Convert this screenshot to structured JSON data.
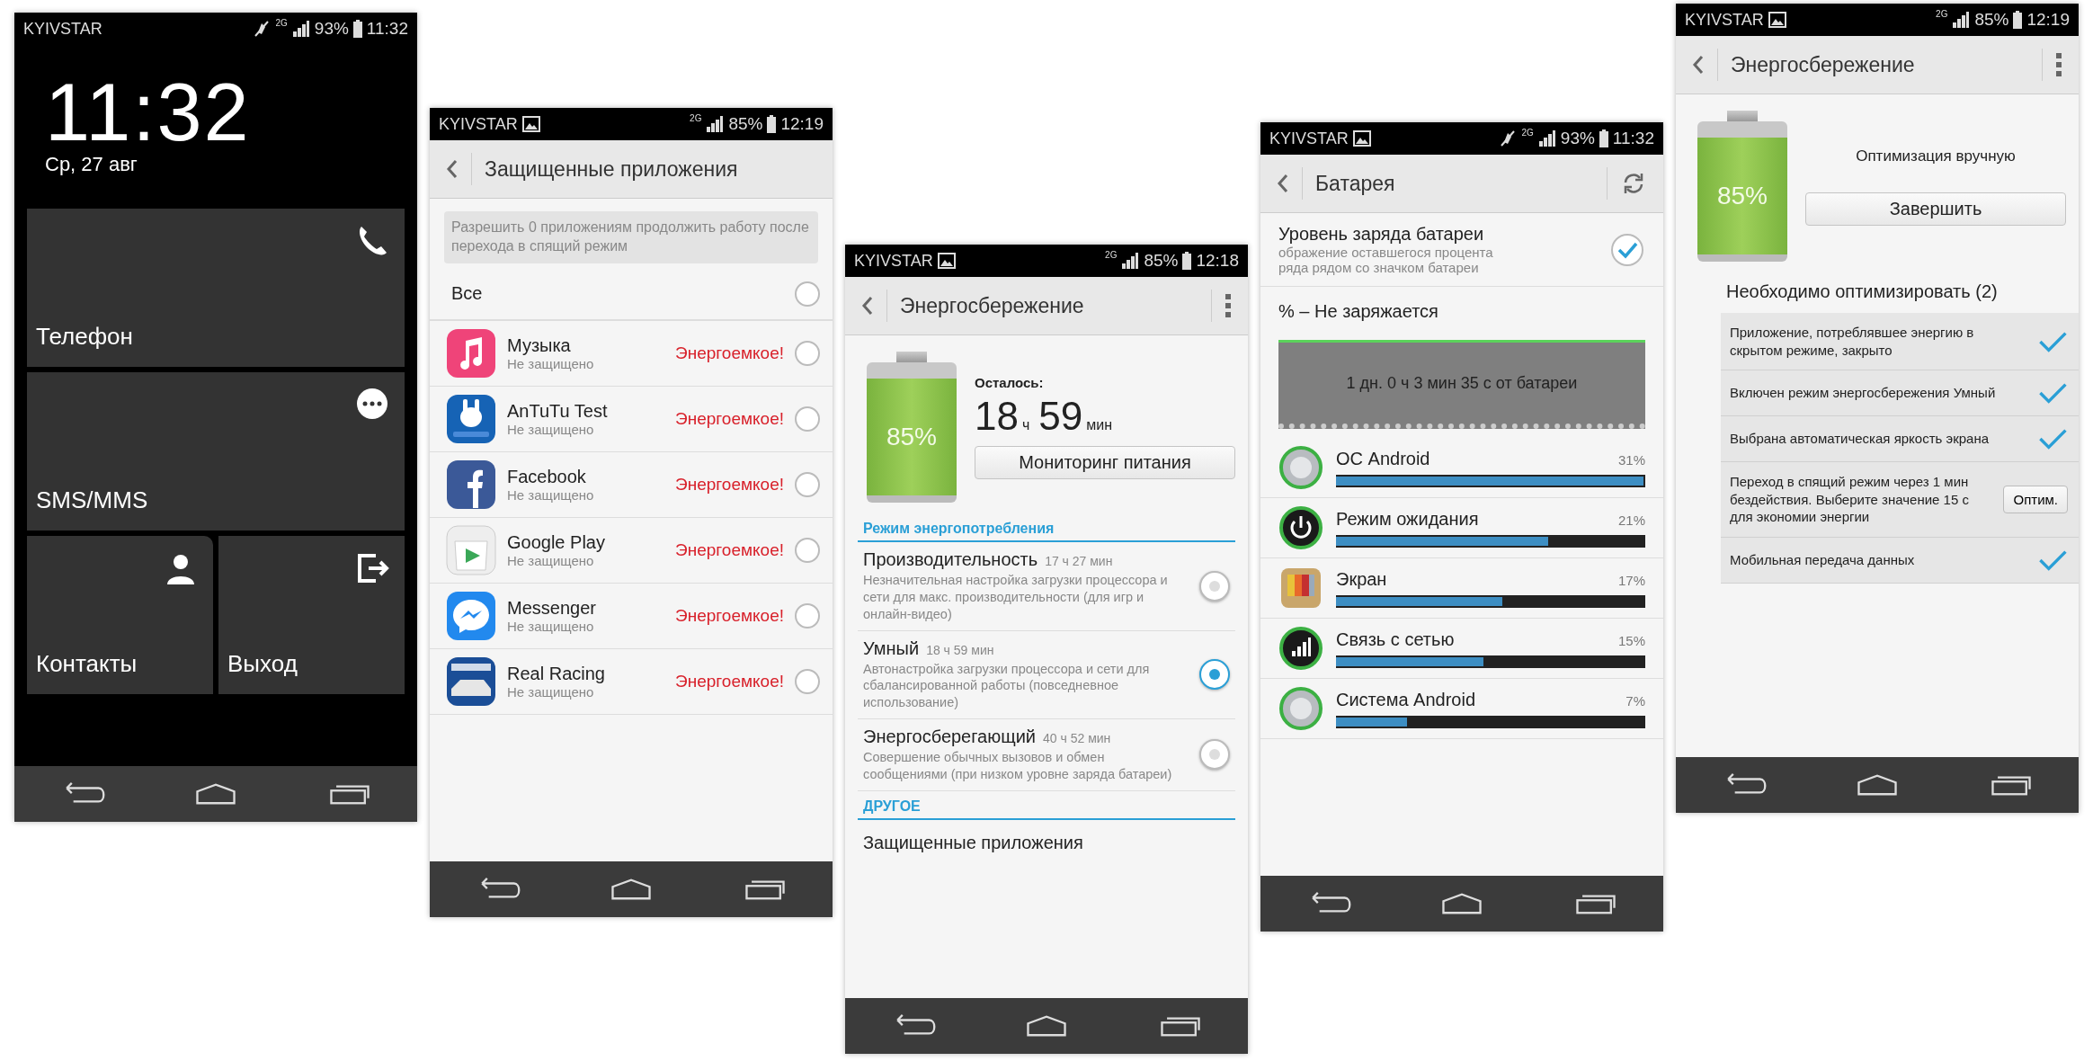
{
  "phones": [
    {
      "kind": "home",
      "status": {
        "carrier": "KYIVSTAR",
        "image_icon": false,
        "muted": true,
        "network": "2G",
        "battery": "93%",
        "time": "11:32"
      },
      "clock": "11:32",
      "date": "Ср, 27 авг",
      "tiles": [
        {
          "label": "Телефон"
        },
        {
          "label": "SMS/MMS"
        },
        {
          "label": "Контакты"
        },
        {
          "label": "Выход"
        }
      ]
    },
    {
      "kind": "protected",
      "status": {
        "carrier": "KYIVSTAR",
        "image_icon": true,
        "muted": false,
        "network": "2G",
        "battery": "85%",
        "time": "12:19"
      },
      "title": "Защищенные приложения",
      "notice": "Разрешить 0 приложениям продолжить работу после перехода в спящий режим",
      "all_label": "Все",
      "all_checked": false,
      "apps": [
        {
          "name": "Музыка",
          "status": "Не защищено",
          "warning": "Энергоемкое!",
          "checked": false
        },
        {
          "name": "AnTuTu Test",
          "status": "Не защищено",
          "warning": "Энергоемкое!",
          "checked": false
        },
        {
          "name": "Facebook",
          "status": "Не защищено",
          "warning": "Энергоемкое!",
          "checked": false
        },
        {
          "name": "Google Play",
          "status": "Не защищено",
          "warning": "Энергоемкое!",
          "checked": false
        },
        {
          "name": "Messenger",
          "status": "Не защищено",
          "warning": "Энергоемкое!",
          "checked": false
        },
        {
          "name": "Real Racing",
          "status": "Не защищено",
          "warning": "Энергоемкое!",
          "checked": false
        }
      ]
    },
    {
      "kind": "power",
      "status": {
        "carrier": "KYIVSTAR",
        "image_icon": true,
        "muted": false,
        "network": "2G",
        "battery": "85%",
        "time": "12:18"
      },
      "title": "Энергосбережение",
      "battery_percent": "85%",
      "remaining_label": "Осталось:",
      "hours": "18",
      "hours_unit": "ч",
      "minutes": "59",
      "minutes_unit": "мин",
      "monitor_button": "Мониторинг питания",
      "section": "Режим энергопотребления",
      "modes": [
        {
          "name": "Производительность",
          "time": "17 ч 27 мин",
          "description": "Незначительная настройка загрузки процессора и сети для макс. производительности (для игр и онлайн-видео)",
          "selected": false
        },
        {
          "name": "Умный",
          "time": "18 ч 59 мин",
          "description": "Автонастройка загрузки процессора и сети для сбалансированной работы (повседневное использование)",
          "selected": true
        },
        {
          "name": "Энергосберегающий",
          "time": "40 ч 52 мин",
          "description": "Совершение обычных вызовов и обмен сообщениями (при низком уровне заряда батареи)",
          "selected": false
        }
      ],
      "other_section": "ДРУГОЕ",
      "other_item": "Защищенные приложения"
    },
    {
      "kind": "battery",
      "status": {
        "carrier": "KYIVSTAR",
        "image_icon": true,
        "muted": true,
        "network": "2G",
        "battery": "93%",
        "time": "11:32"
      },
      "title": "Батарея",
      "setting": {
        "title": "Уровень заряда батареи",
        "description_lines": [
          "ображение оставшегося процента",
          "ряда рядом со значком батареи"
        ],
        "checked": true
      },
      "charge_status": "% – Не заряжается",
      "graph_caption": "1 дн. 0 ч 3 мин 35 с от батареи",
      "usage": [
        {
          "name": "ОС Android",
          "percent": "31%",
          "level": 1.0
        },
        {
          "name": "Режим ожидания",
          "percent": "21%",
          "level": 0.69
        },
        {
          "name": "Экран",
          "percent": "17%",
          "level": 0.54
        },
        {
          "name": "Связь с сетью",
          "percent": "15%",
          "level": 0.48
        },
        {
          "name": "Система Android",
          "percent": "7%",
          "level": 0.23
        }
      ]
    },
    {
      "kind": "optimize",
      "status": {
        "carrier": "KYIVSTAR",
        "image_icon": true,
        "muted": false,
        "network": "2G",
        "battery": "85%",
        "time": "12:19"
      },
      "title": "Энергосбережение",
      "battery_percent": "85%",
      "mode_label": "Оптимизация вручную",
      "finish_button": "Завершить",
      "heading": "Необходимо оптимизировать (2)",
      "items": [
        {
          "text": "Приложение, потреблявшее энергию в скрытом режиме, закрыто",
          "kind": "done"
        },
        {
          "text": "Включен режим энергосбережения Умный",
          "kind": "done"
        },
        {
          "text": "Выбрана автоматическая яркость экрана",
          "kind": "done"
        },
        {
          "text": "Переход в спящий режим через 1 мин бездействия. Выберите значение 15 с для экономии энергии",
          "kind": "action",
          "button": "Оптим."
        },
        {
          "text": "Мобильная передача данных",
          "kind": "done"
        }
      ]
    }
  ]
}
